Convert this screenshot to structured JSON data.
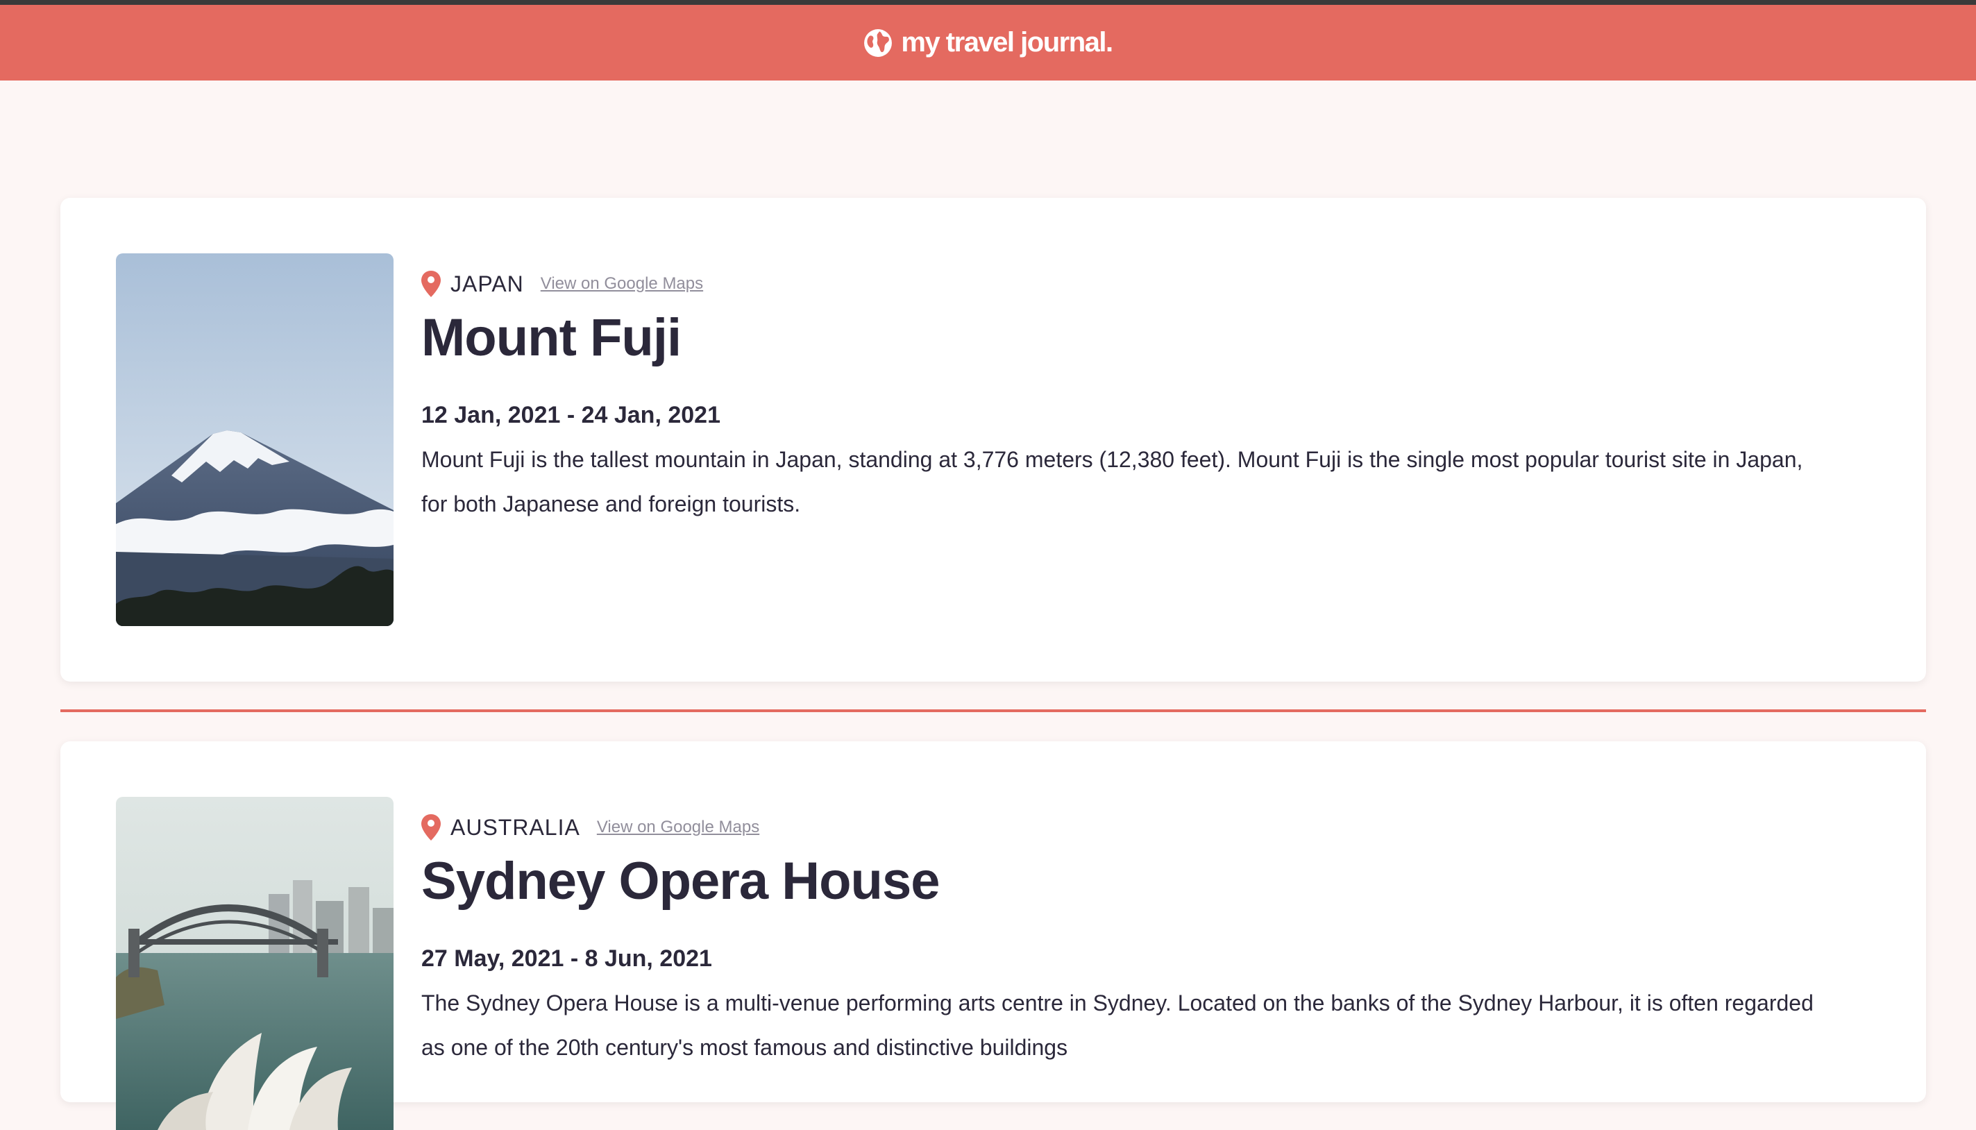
{
  "header": {
    "brand": "my travel journal.",
    "icon": "globe-icon"
  },
  "colors": {
    "accent": "#e46a60",
    "text": "#2b283a",
    "muted": "#918e9b",
    "background": "#fdf6f5"
  },
  "entries": [
    {
      "country": "JAPAN",
      "maps_link": "View on Google Maps",
      "title": "Mount Fuji",
      "dates": "12 Jan, 2021 - 24 Jan, 2021",
      "description": "Mount Fuji is the tallest mountain in Japan, standing at 3,776 meters (12,380 feet). Mount Fuji is the single most popular tourist site in Japan, for both Japanese and foreign tourists."
    },
    {
      "country": "AUSTRALIA",
      "maps_link": "View on Google Maps",
      "title": "Sydney Opera House",
      "dates": "27 May, 2021 - 8 Jun, 2021",
      "description": "The Sydney Opera House is a multi-venue performing arts centre in Sydney. Located on the banks of the Sydney Harbour, it is often regarded as one of the 20th century's most famous and distinctive buildings"
    }
  ]
}
